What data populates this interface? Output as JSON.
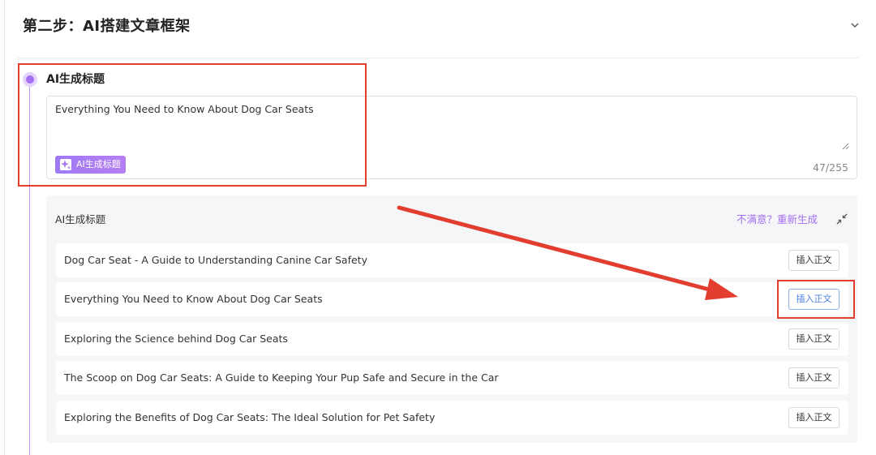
{
  "step": {
    "title": "第二步：AI搭建文章框架"
  },
  "title_section": {
    "label": "AI生成标题",
    "value": "Everything You Need to Know About Dog Car Seats",
    "generate_button": "AI生成标题",
    "char_count": "47/255"
  },
  "suggestions_panel": {
    "title": "AI生成标题",
    "regenerate_link": "不满意？重新生成",
    "items": [
      {
        "text": "Dog Car Seat - A Guide to Understanding Canine Car Safety",
        "button": "插入正文"
      },
      {
        "text": "Everything You Need to Know About Dog Car Seats",
        "button": "插入正文"
      },
      {
        "text": "Exploring the Science behind Dog Car Seats",
        "button": "插入正文"
      },
      {
        "text": "The Scoop on Dog Car Seats: A Guide to Keeping Your Pup Safe and Secure in the Car",
        "button": "插入正文"
      },
      {
        "text": "Exploring the Benefits of Dog Car Seats: The Ideal Solution for Pet Safety",
        "button": "插入正文"
      }
    ]
  },
  "colors": {
    "accent_purple": "#a46ff0",
    "annotation_red": "#e23d2e",
    "active_button_blue": "#4a7fe0"
  }
}
